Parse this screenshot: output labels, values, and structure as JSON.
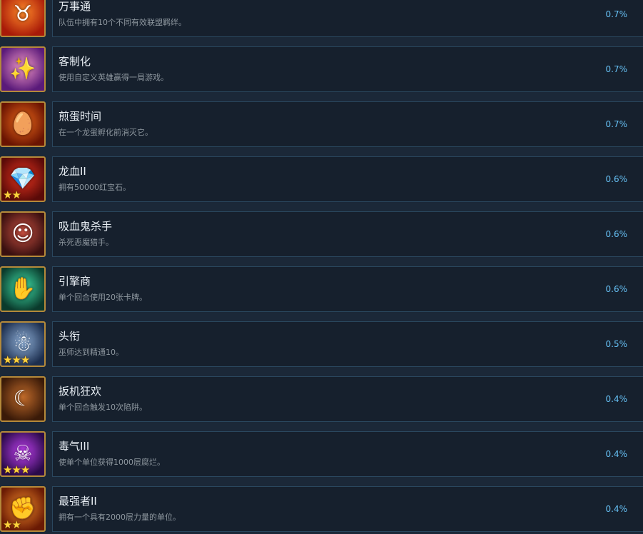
{
  "achievements": [
    {
      "title": "万事通",
      "description": "队伍中拥有10个不同有效联盟羁绊。",
      "percent": "0.7%",
      "icon": "horned-skull-shield-icon",
      "icon_glyph": "♉",
      "stars": "",
      "colors": [
        "#ff8a2a",
        "#a81a08"
      ]
    },
    {
      "title": "客制化",
      "description": "使用自定义英雄赢得一局游戏。",
      "percent": "0.7%",
      "icon": "magic-burst-icon",
      "icon_glyph": "✨",
      "stars": "",
      "colors": [
        "#f59ac8",
        "#5a1a7a"
      ]
    },
    {
      "title": "煎蛋时间",
      "description": "在一个龙蛋孵化前消灭它。",
      "percent": "0.7%",
      "icon": "dragon-egg-icon",
      "icon_glyph": "🥚",
      "stars": "",
      "colors": [
        "#f06a1a",
        "#6a1402"
      ]
    },
    {
      "title": "龙血II",
      "description": "拥有50000红宝石。",
      "percent": "0.6%",
      "icon": "ruby-gem-icon",
      "icon_glyph": "💎",
      "stars": "★★",
      "colors": [
        "#e8341f",
        "#5a0a08"
      ]
    },
    {
      "title": "吸血鬼杀手",
      "description": "杀死恶魔猎手。",
      "percent": "0.6%",
      "icon": "demon-hunter-portrait-icon",
      "icon_glyph": "☺",
      "stars": "",
      "colors": [
        "#c85040",
        "#3a1010"
      ]
    },
    {
      "title": "引擎商",
      "description": "单个回合使用20张卡牌。",
      "percent": "0.6%",
      "icon": "glowing-hand-icon",
      "icon_glyph": "✋",
      "stars": "",
      "colors": [
        "#3fe0a8",
        "#0a3a2c"
      ]
    },
    {
      "title": "头衔",
      "description": "巫师达到精通10。",
      "percent": "0.5%",
      "icon": "white-haired-wizard-icon",
      "icon_glyph": "☃",
      "stars": "★★★",
      "colors": [
        "#8fb0d8",
        "#1c2e4e"
      ]
    },
    {
      "title": "扳机狂欢",
      "description": "单个回合触发10次陷阱。",
      "percent": "0.4%",
      "icon": "trap-card-icon",
      "icon_glyph": "☾",
      "stars": "",
      "colors": [
        "#c06a2a",
        "#3a1a08"
      ]
    },
    {
      "title": "毒气III",
      "description": "使单个单位获得1000层腐烂。",
      "percent": "0.4%",
      "icon": "poison-skull-icon",
      "icon_glyph": "☠",
      "stars": "★★★",
      "colors": [
        "#c040f0",
        "#2a0a4a"
      ]
    },
    {
      "title": "最强者II",
      "description": "拥有一个具有2000层力量的单位。",
      "percent": "0.4%",
      "icon": "raised-fist-icon",
      "icon_glyph": "✊",
      "stars": "★★",
      "colors": [
        "#f0882a",
        "#6a1a04"
      ]
    }
  ]
}
